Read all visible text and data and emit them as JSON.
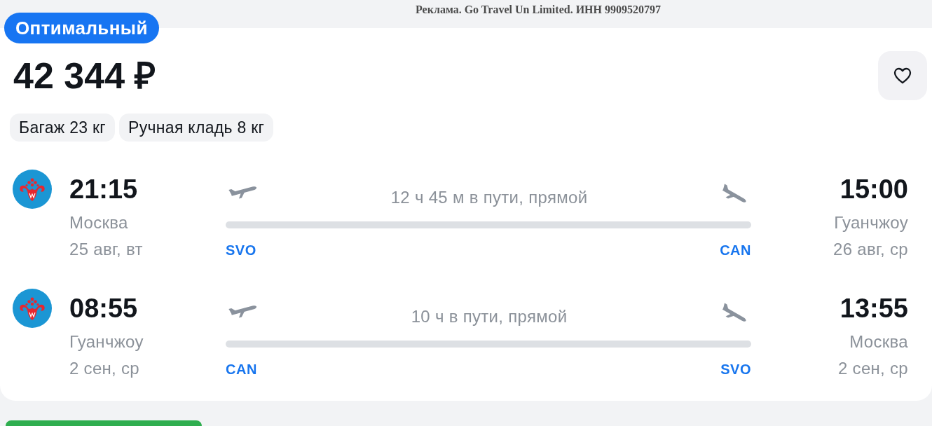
{
  "ad_notice": "Реклама. Go Travel Un Limited. ИНН 9909520797",
  "badge": "Оптимальный",
  "price": "42 344 ₽",
  "favorite_button": {
    "on": false
  },
  "baggage_tags": [
    "Багаж 23 кг",
    "Ручная кладь 8 кг"
  ],
  "flights": [
    {
      "departure": {
        "time": "21:15",
        "city": "Москва",
        "date": "25 авг, вт",
        "airport": "SVO"
      },
      "duration": "12 ч 45 м в пути, прямой",
      "arrival": {
        "time": "15:00",
        "city": "Гуанчжоу",
        "date": "26 авг, ср",
        "airport": "CAN"
      }
    },
    {
      "departure": {
        "time": "08:55",
        "city": "Гуанчжоу",
        "date": "2 сен, ср",
        "airport": "CAN"
      },
      "duration": "10 ч в пути, прямой",
      "arrival": {
        "time": "13:55",
        "city": "Москва",
        "date": "2 сен, ср",
        "airport": "SVO"
      }
    }
  ]
}
